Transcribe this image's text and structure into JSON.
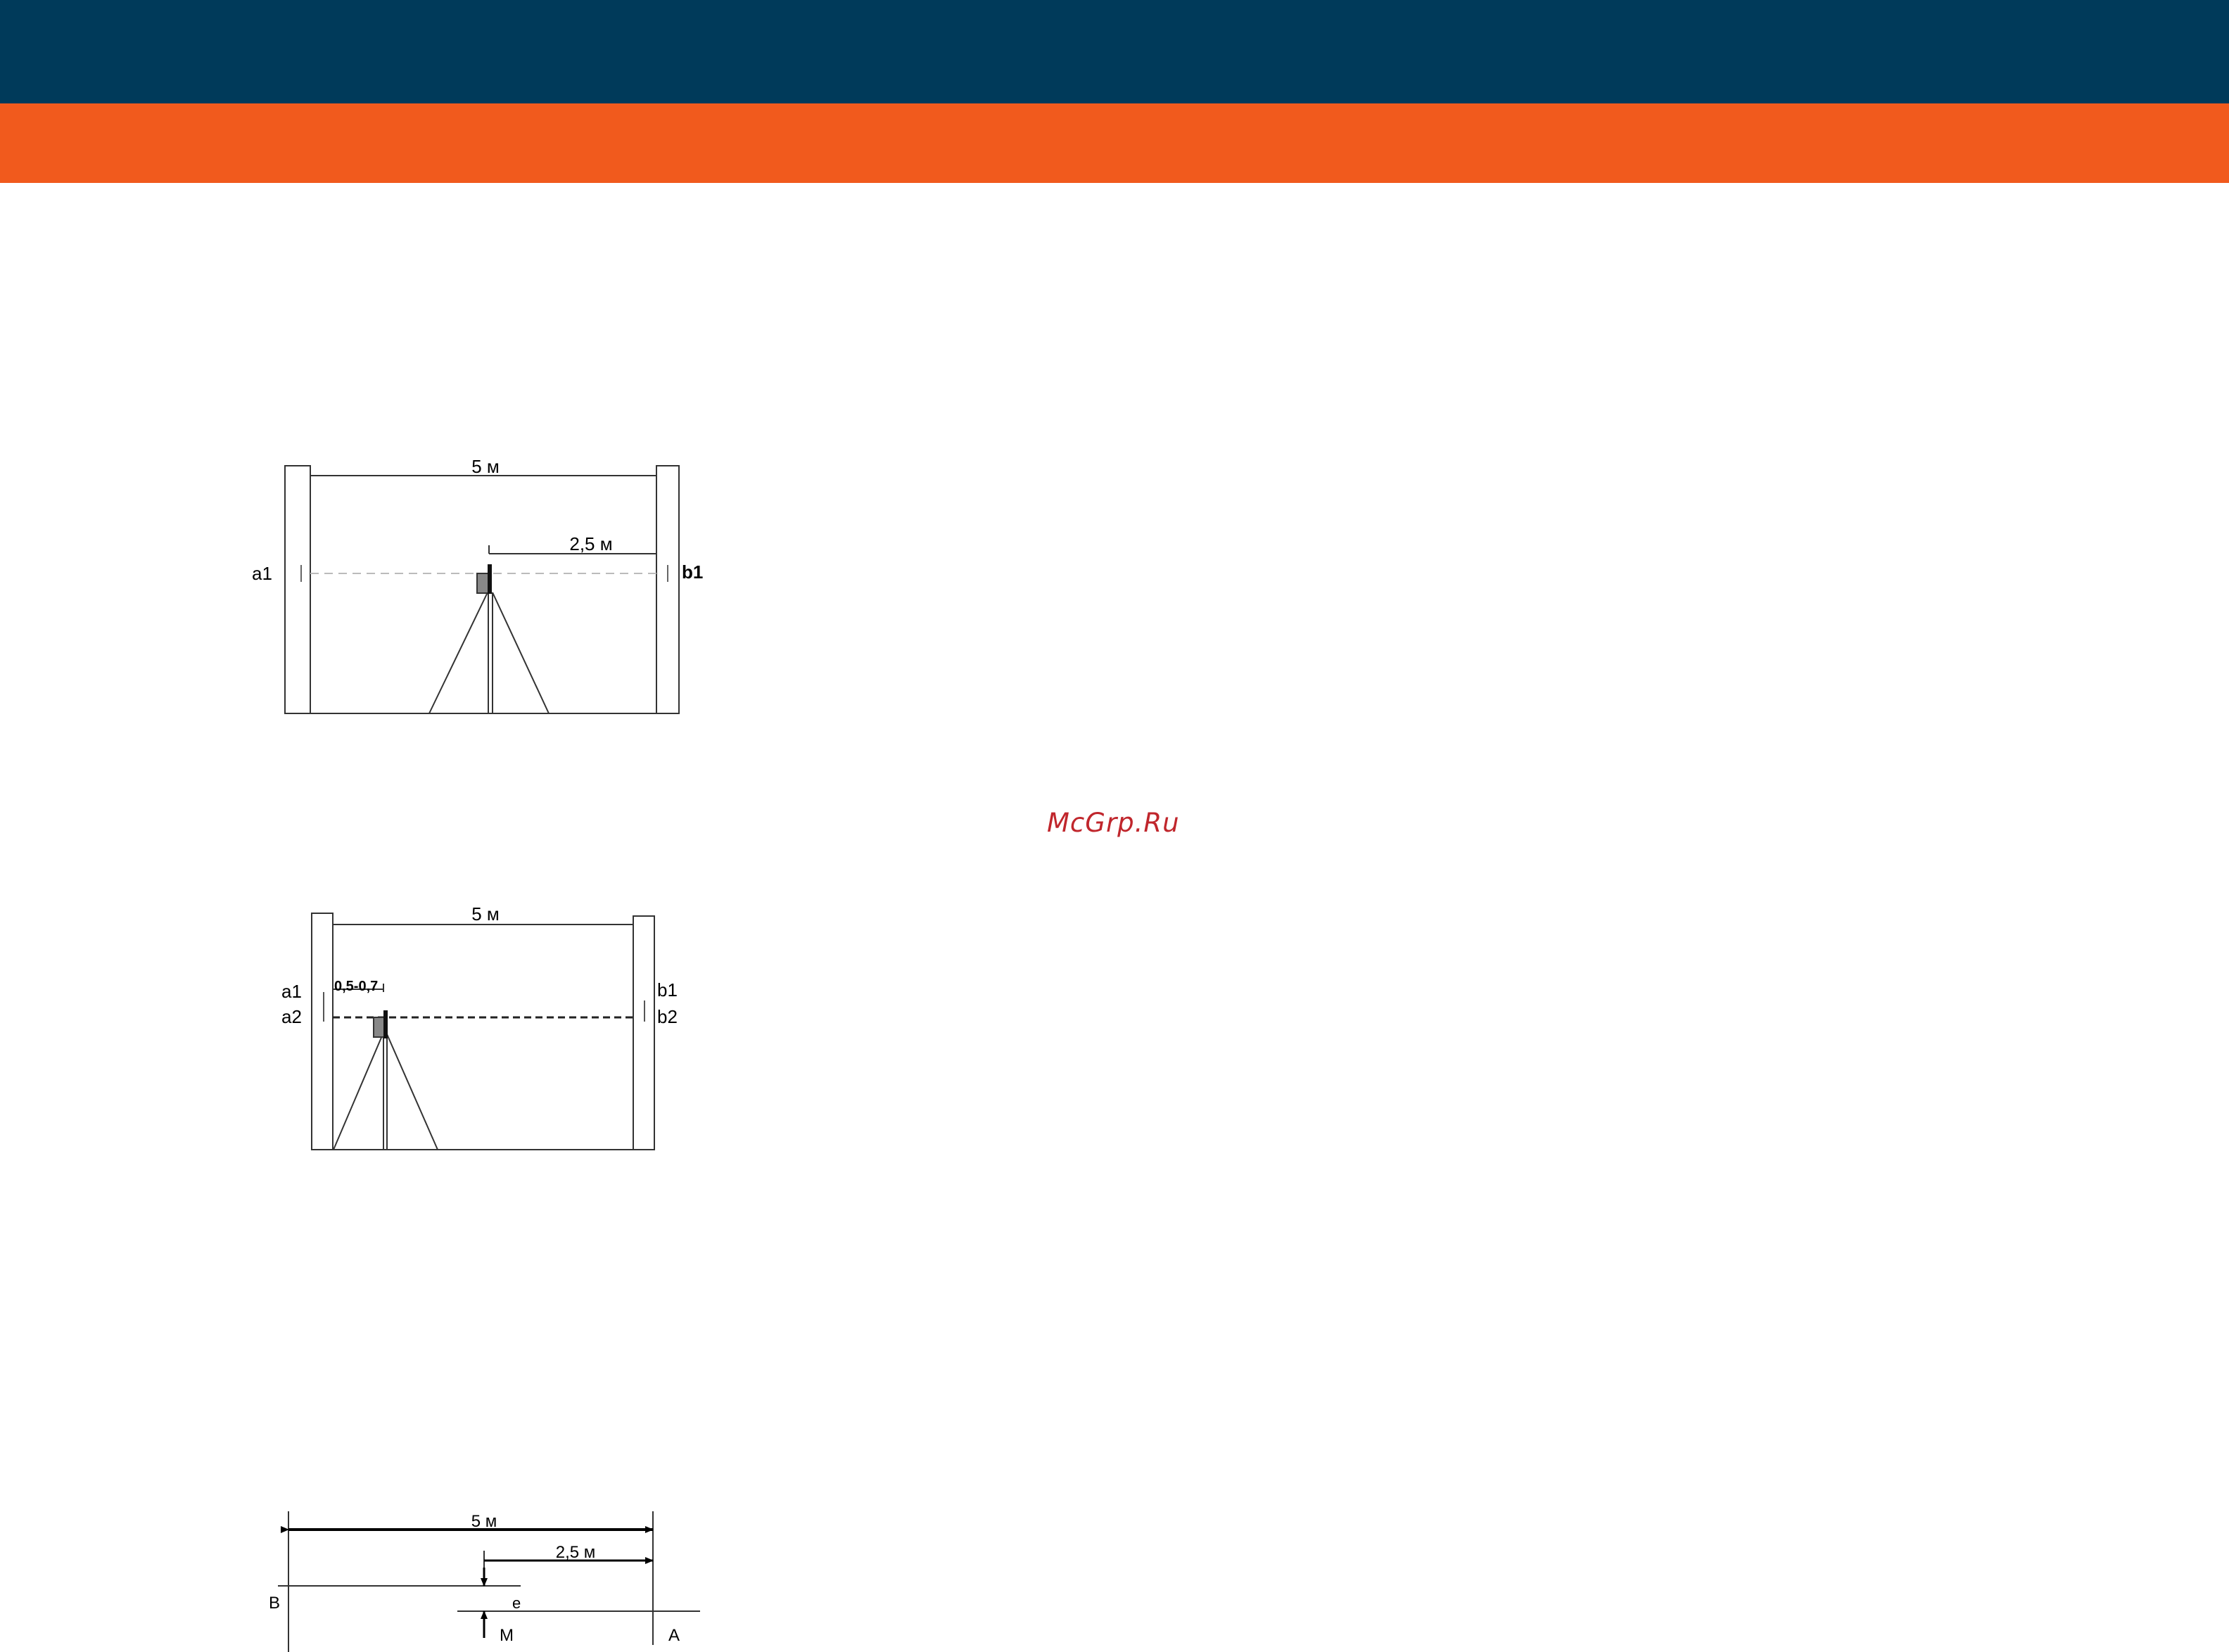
{
  "header": {
    "colors": {
      "primary": "#003a5a",
      "accent": "#f15a1d"
    }
  },
  "watermark": {
    "text": "McGrp.Ru",
    "color": "#c0262c"
  },
  "figure1": {
    "width_label": "5 м",
    "half_label": "2,5 м",
    "left_mark": "a1",
    "right_mark": "b1"
  },
  "figure2": {
    "width_label": "5 м",
    "offset_label": "0,5-0,7",
    "left_mark_1": "a1",
    "left_mark_2": "a2",
    "right_mark_1": "b1",
    "right_mark_2": "b2"
  },
  "figure3": {
    "width_label": "5 м",
    "half_label": "2,5 м",
    "deviation_label": "e",
    "point_b": "B",
    "point_a": "A",
    "point_m": "M"
  }
}
